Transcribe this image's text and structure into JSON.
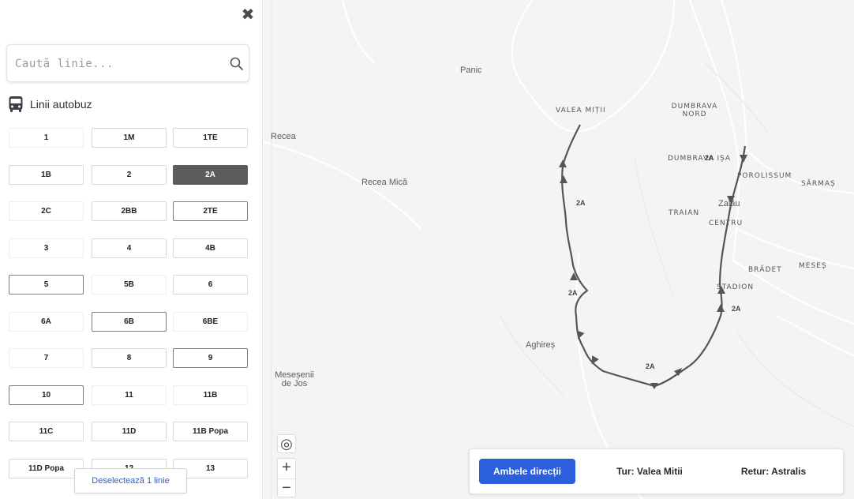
{
  "panel": {
    "search": {
      "placeholder": "Caută linie..."
    },
    "section_title": "Linii autobuz",
    "lines": [
      {
        "label": "1",
        "style": "faint"
      },
      {
        "label": "1M",
        "style": "normal"
      },
      {
        "label": "1TE",
        "style": "normal"
      },
      {
        "label": "1B",
        "style": "normal"
      },
      {
        "label": "2",
        "style": "normal"
      },
      {
        "label": "2A",
        "style": "selected"
      },
      {
        "label": "2C",
        "style": "faint"
      },
      {
        "label": "2BB",
        "style": "normal"
      },
      {
        "label": "2TE",
        "style": "dark"
      },
      {
        "label": "3",
        "style": "faint"
      },
      {
        "label": "4",
        "style": "normal"
      },
      {
        "label": "4B",
        "style": "normal"
      },
      {
        "label": "5",
        "style": "dark"
      },
      {
        "label": "5B",
        "style": "faint"
      },
      {
        "label": "6",
        "style": "normal"
      },
      {
        "label": "6A",
        "style": "faint"
      },
      {
        "label": "6B",
        "style": "dark"
      },
      {
        "label": "6BE",
        "style": "faint"
      },
      {
        "label": "7",
        "style": "faint"
      },
      {
        "label": "8",
        "style": "normal"
      },
      {
        "label": "9",
        "style": "dark"
      },
      {
        "label": "10",
        "style": "dark"
      },
      {
        "label": "11",
        "style": "faint"
      },
      {
        "label": "11B",
        "style": "faint"
      },
      {
        "label": "11C",
        "style": "normal"
      },
      {
        "label": "11D",
        "style": "normal"
      },
      {
        "label": "11B Popa",
        "style": "normal"
      },
      {
        "label": "11D Popa",
        "style": "normal"
      },
      {
        "label": "12",
        "style": "normal"
      },
      {
        "label": "13",
        "style": "normal"
      }
    ],
    "deselect_label": "Deselectează 1 linie"
  },
  "map": {
    "places": [
      {
        "name": "Panic"
      },
      {
        "name": "Recea"
      },
      {
        "name": "Recea Mică"
      },
      {
        "name": "VALEA MIȚII"
      },
      {
        "name": "DUMBRAVA NORD"
      },
      {
        "name": "DUMBRAVA IȘA"
      },
      {
        "name": "POROLISSUM"
      },
      {
        "name": "SĂRMAȘ"
      },
      {
        "name": "TRAIAN"
      },
      {
        "name": "Zalău"
      },
      {
        "name": "CENTRU"
      },
      {
        "name": "BRĂDET"
      },
      {
        "name": "MESEȘ"
      },
      {
        "name": "STADION"
      },
      {
        "name": "Aghireș"
      },
      {
        "name": "Meseșenii de Jos"
      }
    ],
    "route_label": "2A",
    "route_label_count": 5,
    "controls": {
      "locate": "◎",
      "zoom_in": "+",
      "zoom_out": "−"
    },
    "directions": {
      "both": "Ambele direcții",
      "tur": "Tur: Valea Mitii",
      "retur": "Retur: Astralis",
      "active": "both",
      "active_color": "#2c5fdc"
    }
  }
}
